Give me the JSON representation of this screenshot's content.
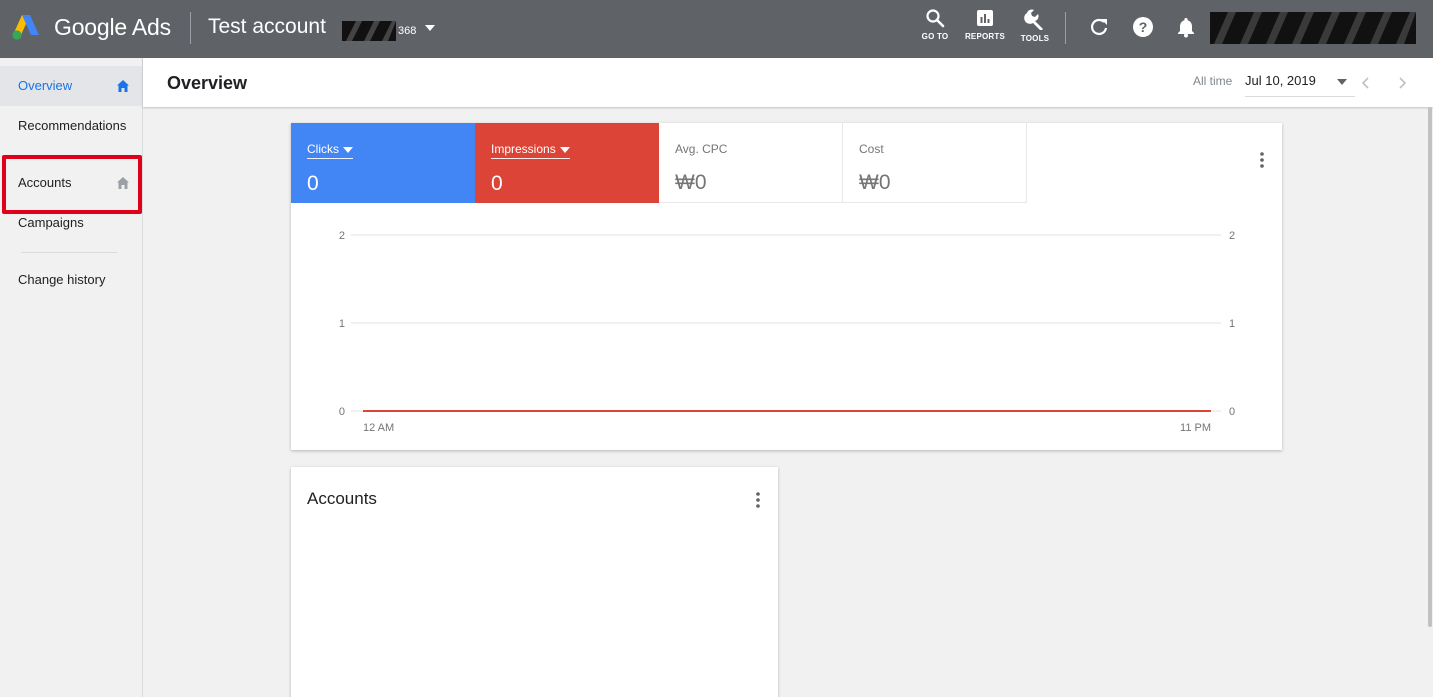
{
  "header": {
    "brand": "Google Ads",
    "account_name": "Test account",
    "account_suffix": "368",
    "tools": [
      {
        "label": "GO TO",
        "icon": "search-icon"
      },
      {
        "label": "REPORTS",
        "icon": "reports-icon"
      },
      {
        "label": "TOOLS",
        "icon": "wrench-icon"
      }
    ],
    "icons": [
      "refresh-icon",
      "help-icon",
      "notifications-icon"
    ]
  },
  "sidenav": {
    "items": [
      {
        "label": "Overview",
        "active": true
      },
      {
        "label": "Recommendations"
      },
      {
        "label": "Accounts"
      },
      {
        "label": "Campaigns"
      },
      {
        "label": "Change history"
      }
    ]
  },
  "topbar": {
    "title": "Overview",
    "range_label": "All time",
    "range_value": "Jul 10, 2019"
  },
  "metrics": [
    {
      "label": "Clicks",
      "value": "0",
      "color": "#4285f4",
      "dropdown": true
    },
    {
      "label": "Impressions",
      "value": "0",
      "color": "#db4437",
      "dropdown": true
    },
    {
      "label": "Avg. CPC",
      "value": "₩0"
    },
    {
      "label": "Cost",
      "value": "₩0"
    }
  ],
  "chart_data": {
    "type": "line",
    "x": [
      "12 AM",
      "11 PM"
    ],
    "series": [
      {
        "values": [
          0,
          0
        ],
        "color": "#4285f4"
      },
      {
        "values": [
          0,
          0
        ],
        "color": "#db4437"
      }
    ],
    "yticks_left": [
      "2",
      "1",
      "0"
    ],
    "yticks_right": [
      "2",
      "1",
      "0"
    ],
    "ylim": [
      0,
      2
    ],
    "grid": true
  },
  "accounts_card": {
    "title": "Accounts"
  },
  "colors": {
    "header_bg": "#5f6368",
    "accent_blue": "#1a73e8",
    "highlight_red": "#e0001a"
  }
}
